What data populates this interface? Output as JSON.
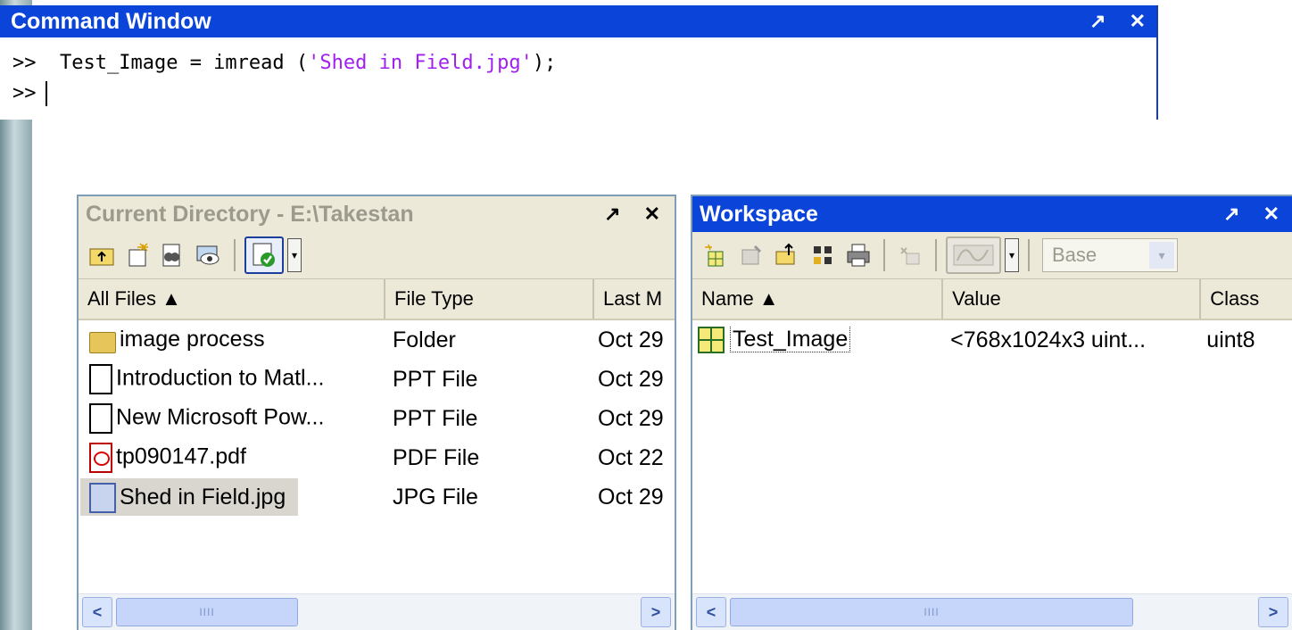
{
  "command_window": {
    "title": "Command Window",
    "undock": "↗",
    "close": "✕",
    "lines": [
      {
        "prompt": ">>",
        "code_pre": "Test_Image = imread (",
        "code_str": "'Shed in Field.jpg'",
        "code_post": ");"
      },
      {
        "prompt": ">>"
      }
    ]
  },
  "current_directory": {
    "title": "Current Directory - E:\\Takestan",
    "undock": "↗",
    "close": "✕",
    "toolbar": [
      "up-folder-icon",
      "new-file-icon",
      "find-files-icon",
      "visdiff-icon",
      "reports-icon"
    ],
    "columns": [
      "All Files ▲",
      "File Type",
      "Last M"
    ],
    "files": [
      {
        "name": "image process",
        "type": "Folder",
        "date": "Oct 29",
        "icon": "folder-icon"
      },
      {
        "name": "Introduction to Matl...",
        "type": "PPT File",
        "date": "Oct 29",
        "icon": "document-icon"
      },
      {
        "name": "New Microsoft Pow...",
        "type": "PPT File",
        "date": "Oct 29",
        "icon": "document-icon"
      },
      {
        "name": "tp090147.pdf",
        "type": "PDF File",
        "date": "Oct 22",
        "icon": "pdf-icon"
      },
      {
        "name": "Shed in Field.jpg",
        "type": "JPG File",
        "date": "Oct 29",
        "icon": "image-file-icon"
      }
    ],
    "scroll_grip": "IIII"
  },
  "workspace": {
    "title": "Workspace",
    "undock": "↗",
    "close": "✕",
    "stack_select": "Base",
    "columns": [
      "Name ▲",
      "Value",
      "Class"
    ],
    "variables": [
      {
        "name": "Test_Image",
        "value": "<768x1024x3 uint...",
        "class": "uint8"
      }
    ],
    "scroll_grip": "IIII"
  }
}
